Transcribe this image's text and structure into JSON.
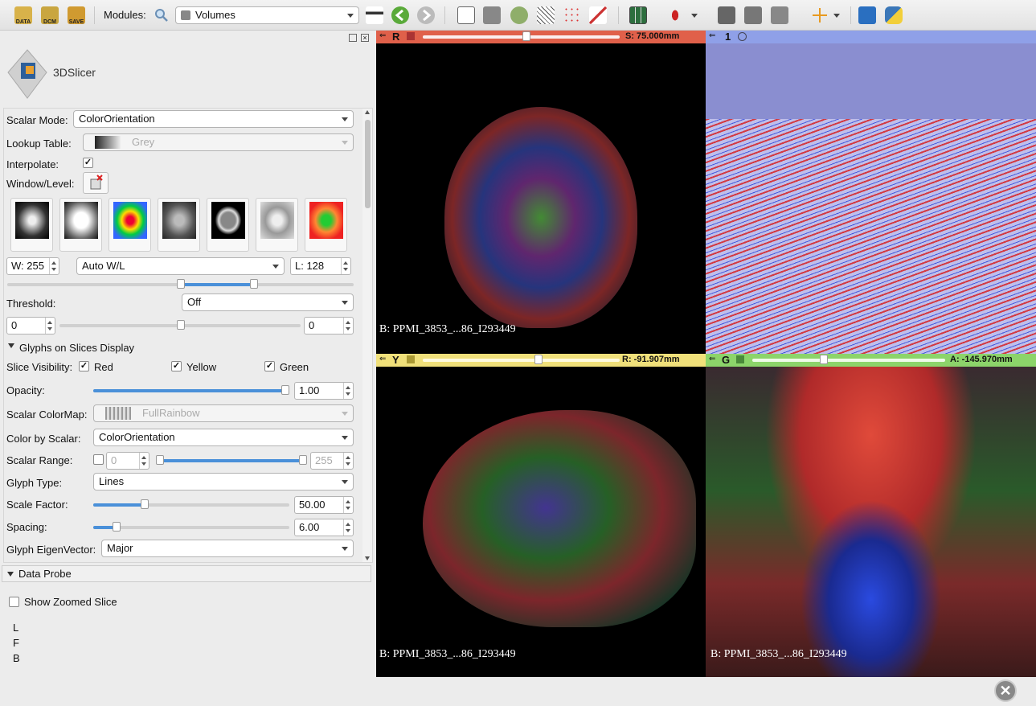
{
  "toolbar": {
    "data_label": "DATA",
    "dcm_label": "DCM",
    "save_label": "SAVE",
    "modules_label": "Modules:",
    "module_selected": "Volumes"
  },
  "logo_text": "3DSlicer",
  "volumes": {
    "scalar_mode_label": "Scalar Mode:",
    "scalar_mode_value": "ColorOrientation",
    "lookup_table_label": "Lookup Table:",
    "lookup_table_value": "Grey",
    "interpolate_label": "Interpolate:",
    "interpolate_checked": "✓",
    "window_level_label": "Window/Level:",
    "w_value": "W: 255",
    "auto_wl": "Auto W/L",
    "l_value": "L: 128",
    "threshold_label": "Threshold:",
    "threshold_value": "Off",
    "threshold_min": "0",
    "threshold_max": "0"
  },
  "glyphs": {
    "section_title": "Glyphs on Slices Display",
    "slice_visibility_label": "Slice Visibility:",
    "red_label": "Red",
    "yellow_label": "Yellow",
    "green_label": "Green",
    "check": "✓",
    "opacity_label": "Opacity:",
    "opacity_value": "1.00",
    "scalar_colormap_label": "Scalar ColorMap:",
    "scalar_colormap_value": "FullRainbow",
    "color_by_scalar_label": "Color by Scalar:",
    "color_by_scalar_value": "ColorOrientation",
    "scalar_range_label": "Scalar Range:",
    "scalar_range_min": "0",
    "scalar_range_max": "255",
    "glyph_type_label": "Glyph Type:",
    "glyph_type_value": "Lines",
    "scale_factor_label": "Scale Factor:",
    "scale_factor_value": "50.00",
    "spacing_label": "Spacing:",
    "spacing_value": "6.00",
    "eigenvector_label": "Glyph EigenVector:",
    "eigenvector_value": "Major"
  },
  "data_probe": {
    "title": "Data Probe",
    "show_zoomed_label": "Show Zoomed Slice",
    "l_label": "L",
    "f_label": "F",
    "b_label": "B"
  },
  "views": {
    "red": {
      "letter": "R",
      "offset": "S: 75.000mm",
      "caption": "B: PPMI_3853_...86_I293449",
      "color": "#e0604a"
    },
    "three_d": {
      "letter": "1",
      "color": "#8fa0e8"
    },
    "yellow": {
      "letter": "Y",
      "offset": "R: -91.907mm",
      "caption": "B: PPMI_3853_...86_I293449",
      "color": "#f0e07a"
    },
    "green": {
      "letter": "G",
      "offset": "A: -145.970mm",
      "caption": "B: PPMI_3853_...86_I293449",
      "color": "#8cd46a"
    }
  }
}
